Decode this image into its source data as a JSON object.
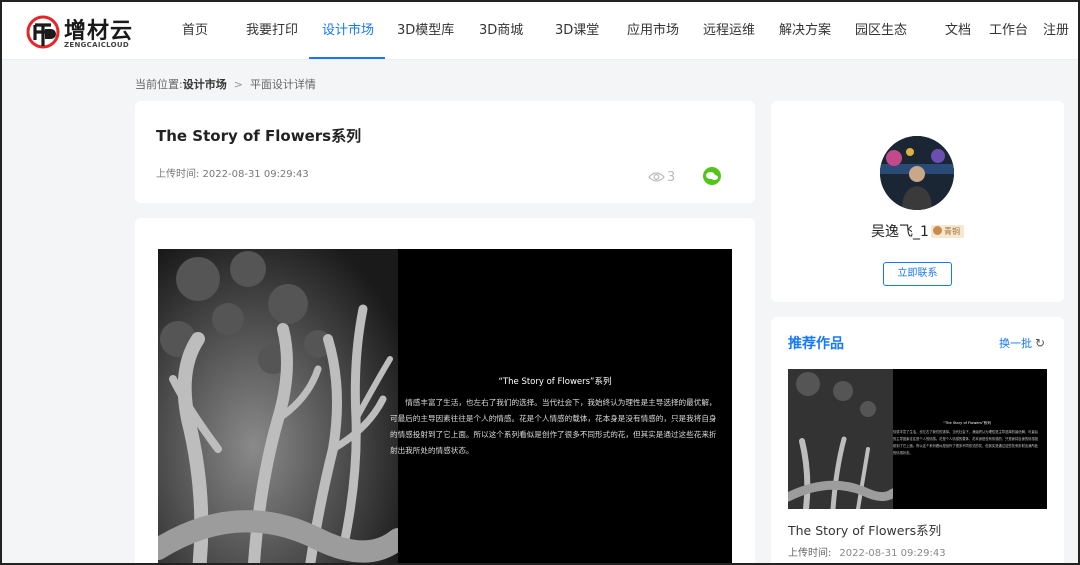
{
  "brand": {
    "name": "增材云",
    "subtitle": "ZENGCAICLOUD"
  },
  "nav": {
    "items": [
      {
        "label": "首页"
      },
      {
        "label": "我要打印"
      },
      {
        "label": "设计市场",
        "active": true
      },
      {
        "label": "3D模型库"
      },
      {
        "label": "3D商城"
      },
      {
        "label": "3D课堂"
      },
      {
        "label": "应用市场"
      },
      {
        "label": "远程运维"
      },
      {
        "label": "解决方案"
      },
      {
        "label": "园区生态"
      },
      {
        "label": "文档"
      },
      {
        "label": "工作台"
      },
      {
        "label": "注册"
      }
    ]
  },
  "breadcrumb": {
    "prefix": "当前位置:",
    "section": "设计市场",
    "separator": ">",
    "current": "平面设计详情"
  },
  "work": {
    "title": "The Story of Flowers系列",
    "upload_time": "上传时间: 2022-08-31 09:29:43",
    "views": "3",
    "poster": {
      "title": "“The Story of Flowers”系列",
      "body": "情感丰富了生活，也左右了我们的选择。当代社会下，我始终认为理性是主导选择的最优解，可最后的主导因素往往是个人的情感。花是个人情感的载体，花本身是没有情感的，只是我将自身的情感投射到了它上面。所以这个系列看似是创作了很多不同形式的花，但其实是通过这些花来折射出我所处的情感状态。"
    }
  },
  "author": {
    "name": "吴逸飞_1",
    "badge": "青铜",
    "contact_label": "立即联系"
  },
  "recommend": {
    "heading": "推荐作品",
    "refresh_label": "换一批",
    "refresh_icon": "refresh-icon",
    "items": [
      {
        "title": "The Story of Flowers系列",
        "time_label": "上传时间:",
        "time_value": "2022-08-31 09:29:43"
      }
    ]
  },
  "colors": {
    "accent": "#1677ff",
    "page_bg": "#f4f5f7",
    "wechat": "#52c41a",
    "logo_red": "#e3262b"
  }
}
